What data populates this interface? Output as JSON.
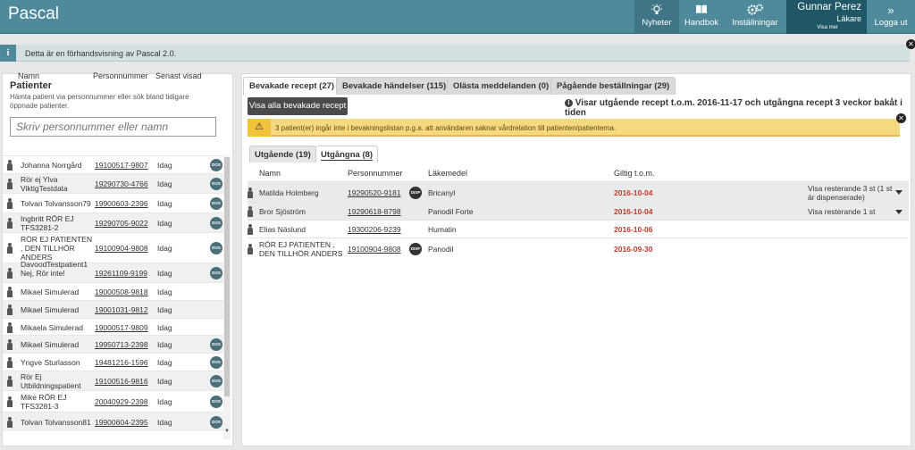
{
  "header": {
    "app_title": "Pascal",
    "nav": {
      "news": "Nyheter",
      "handbook": "Handbok",
      "settings": "Inställningar",
      "logout": "Logga ut"
    },
    "user": {
      "name": "Gunnar Perez",
      "role": "Läkare",
      "more": "Visa mer"
    }
  },
  "info_banner": {
    "icon": "info-icon",
    "text": "Detta är en förhandsvisning av Pascal 2.0."
  },
  "patients_panel": {
    "title": "Patienter",
    "description": "Hämta patient via personnummer eller sök bland tidigare öppnade patienter.",
    "search_placeholder": "Skriv personnummer eller namn",
    "columns": {
      "name": "Namn",
      "pnr": "Personnummer",
      "seen": "Senast visad"
    },
    "rows": [
      {
        "name": "Johanna Norrgård",
        "pnr": "19100517-9807",
        "seen": "Idag",
        "dos": true
      },
      {
        "name": "Rör ej Ylva ViktigTestdata",
        "pnr": "19290730-4766",
        "seen": "Idag",
        "dos": true
      },
      {
        "name": "Tolvan Tolvansson79",
        "pnr": "19900603-2396",
        "seen": "Idag",
        "dos": true
      },
      {
        "name": "Ingbritt RÖR EJ TFS3281-2",
        "pnr": "19290705-9022",
        "seen": "Idag",
        "dos": true
      },
      {
        "name": "RÖR EJ PATIENTEN , DEN TILLHÖR ANDERS",
        "pnr": "19100904-9808",
        "seen": "Idag",
        "dos": true
      },
      {
        "name": "DavoodTestpatient1 Nej, Rör inte!",
        "pnr": "19261109-9199",
        "seen": "Idag",
        "dos": true
      },
      {
        "name": "Mikael Simulerad",
        "pnr": "19000508-9818",
        "seen": "Idag",
        "dos": false
      },
      {
        "name": "Mikael Simulerad",
        "pnr": "19001031-9812",
        "seen": "Idag",
        "dos": false
      },
      {
        "name": "Mikaela Simulerad",
        "pnr": "19000517-9809",
        "seen": "Idag",
        "dos": false
      },
      {
        "name": "Mikael Simulerad",
        "pnr": "19950713-2398",
        "seen": "Idag",
        "dos": true
      },
      {
        "name": "Yngve Sturlasson",
        "pnr": "19481216-1596",
        "seen": "Idag",
        "dos": true
      },
      {
        "name": "Rör Ej Utbildningspatient",
        "pnr": "19100516-9816",
        "seen": "Idag",
        "dos": true
      },
      {
        "name": "Mike RÖR EJ TFS3281-3",
        "pnr": "20040929-2398",
        "seen": "Idag",
        "dos": true
      },
      {
        "name": "Tolvan Tolvansson81",
        "pnr": "19900604-2395",
        "seen": "Idag",
        "dos": true
      }
    ],
    "dos_label": "DOS"
  },
  "tabs": [
    {
      "label": "Bevakade recept (27)",
      "active": true
    },
    {
      "label": "Bevakade händelser (115)",
      "active": false
    },
    {
      "label": "Olästa meddelanden (0)",
      "active": false
    },
    {
      "label": "Pågående beställningar (29)",
      "active": false
    }
  ],
  "watched": {
    "show_all_button": "Visa alla bevakade recept",
    "showing_text": "Visar utgående recept t.o.m. 2016-11-17 och utgångna recept 3 veckor bakåt i tiden",
    "warning_icon": "warning-icon",
    "warning_text": "3 patient(er) ingår inte i bevakningslistan p.g.a. att användaren saknar vårdrelation till patienten/patienterna.",
    "subtabs": [
      {
        "label": "Utgående (19)",
        "active": true
      },
      {
        "label": "Utgångna (8)",
        "active": false
      }
    ],
    "columns": {
      "name": "Namn",
      "pnr": "Personnummer",
      "drug": "Läkemedel",
      "valid": "Giltig t.o.m."
    },
    "disp_label": "DISP",
    "rows": [
      {
        "name": "Matilda Holmberg",
        "pnr": "19290520-9181",
        "disp": true,
        "drug": "Bricanyl",
        "valid": "2016-10-04",
        "rest": "Visa resterande 3 st (1 st är dispenserade)",
        "expand": true
      },
      {
        "name": "Bror Sjöström",
        "pnr": "19290618-8798",
        "disp": false,
        "drug": "Panodil Forte",
        "valid": "2016-10-04",
        "rest": "Visa resterande 1 st",
        "expand": true
      },
      {
        "name": "Elias Näslund",
        "pnr": "19300206-9239",
        "disp": false,
        "drug": "Humatin",
        "valid": "2016-10-06",
        "rest": "",
        "expand": false
      },
      {
        "name": "RÖR EJ PATIENTEN , DEN TILLHÖR ANDERS",
        "pnr": "19100904-9808",
        "disp": true,
        "drug": "Panodil",
        "valid": "2016-09-30",
        "rest": "",
        "expand": false
      }
    ]
  },
  "colors": {
    "header_bg": "#4e8a9a",
    "user_bg": "#1f5766",
    "warning_bg": "#f6d97e",
    "expired_date": "#c0392b"
  }
}
